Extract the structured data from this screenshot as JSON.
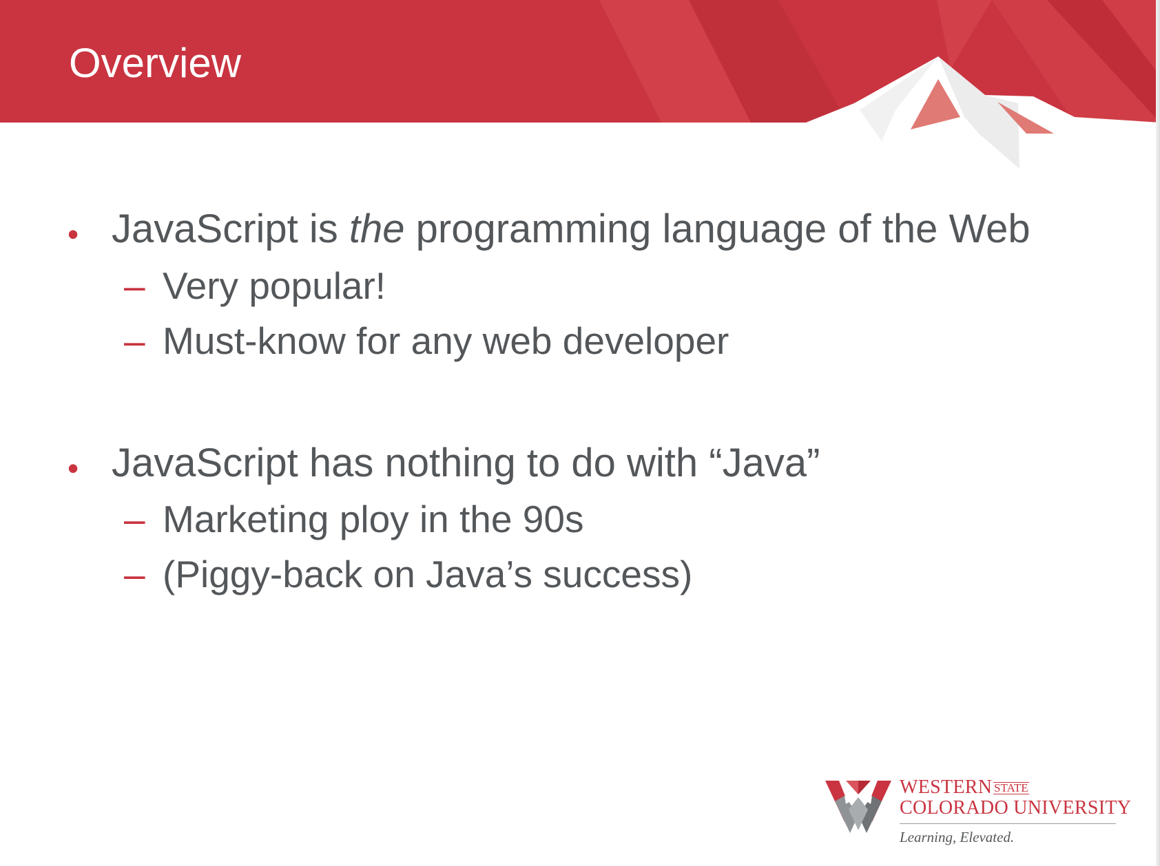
{
  "slide": {
    "title": "Overview",
    "bullets": [
      {
        "text_before": "JavaScript is ",
        "text_em": "the",
        "text_after": " programming language of the Web",
        "subitems": [
          "Very popular!",
          "Must-know for any web developer"
        ]
      },
      {
        "text_before": "JavaScript has nothing to do with “Java”",
        "text_em": "",
        "text_after": "",
        "subitems": [
          "Marketing ploy in the 90s",
          "(Piggy-back on Java’s success)"
        ]
      }
    ],
    "bullet_glyph": "•",
    "sub_glyph": "–"
  },
  "logo": {
    "western": "WESTERN",
    "state": "STATE",
    "colorado_university": "COLORADO UNIVERSITY",
    "tagline": "Learning, Elevated."
  },
  "colors": {
    "brand_red": "#c93440",
    "text_gray": "#54575a"
  }
}
